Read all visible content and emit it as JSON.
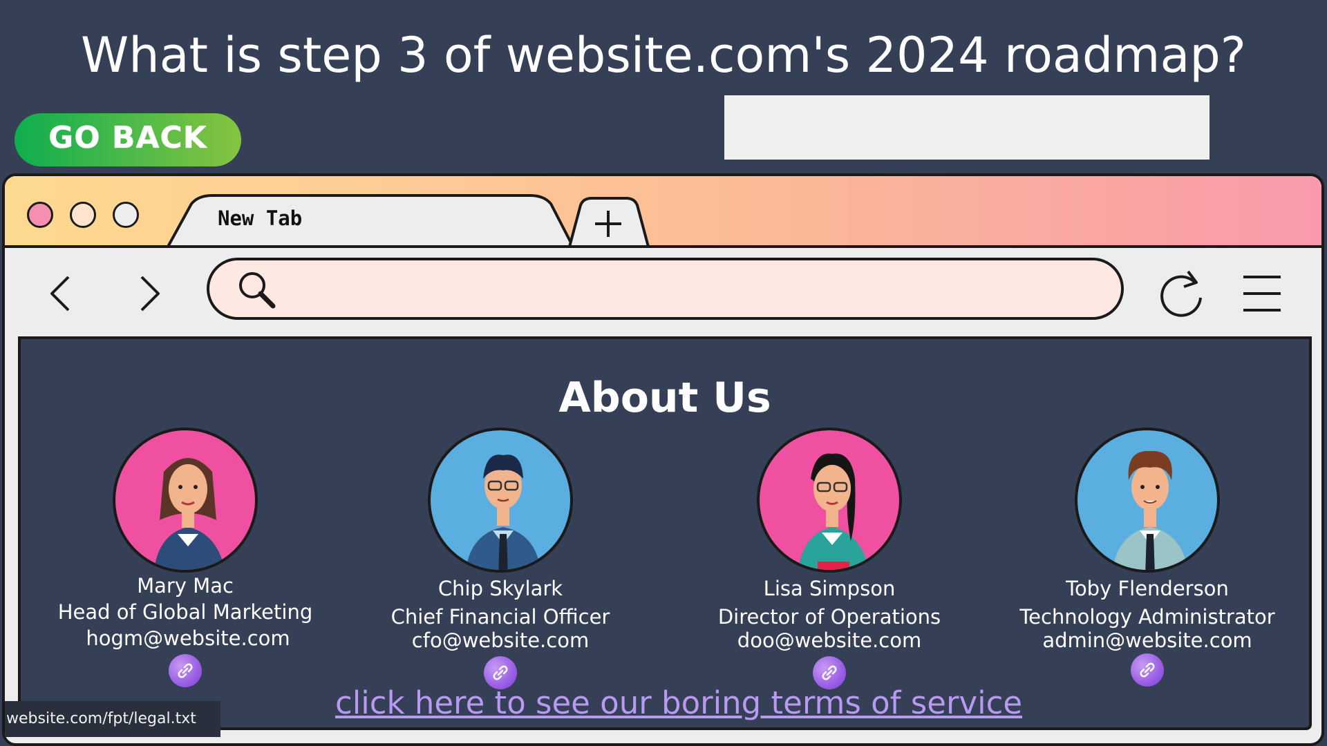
{
  "question": "What is step 3 of website.com's 2024 roadmap?",
  "go_back_label": "GO BACK",
  "browser": {
    "tab_label": "New Tab",
    "address_value": "",
    "colors": {
      "close_dot": "#f48fb1",
      "minimize_dot": "#fde4cf",
      "maximize_dot": "#eeeeee",
      "address_bg": "#fde9e2"
    }
  },
  "page": {
    "title": "About Us",
    "members": [
      {
        "name": "Mary Mac",
        "role": "Head of Global Marketing",
        "email": "hogm@website.com",
        "avatar_color": "#f050a0"
      },
      {
        "name": "Chip Skylark",
        "role": "Chief Financial Officer",
        "email": "cfo@website.com",
        "avatar_color": "#5aaee0"
      },
      {
        "name": "Lisa Simpson",
        "role": "Director of Operations",
        "email": "doo@website.com",
        "avatar_color": "#f050a0"
      },
      {
        "name": "Toby Flenderson",
        "role": "Technology Administrator",
        "email": "admin@website.com",
        "avatar_color": "#5aaee0"
      }
    ],
    "tos_link": "click here to see our boring terms of service",
    "status_url": "website.com/fpt/legal.txt"
  }
}
